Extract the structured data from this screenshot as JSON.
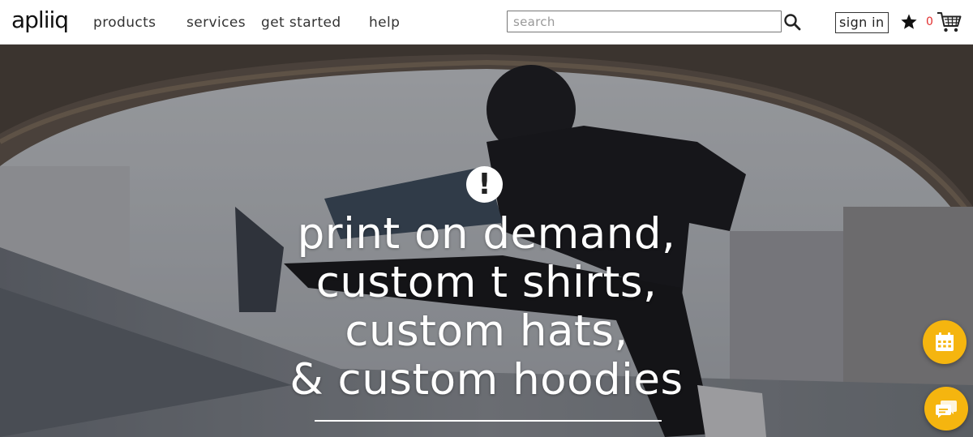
{
  "brand": {
    "logo_text": "apliiq"
  },
  "nav": {
    "items": [
      {
        "label": "products"
      },
      {
        "label": "services"
      },
      {
        "label": "get started"
      },
      {
        "label": "help"
      }
    ]
  },
  "search": {
    "placeholder": "search",
    "value": ""
  },
  "account": {
    "signin_label": "sign in",
    "cart_count": "0"
  },
  "hero": {
    "lines": [
      "print on demand,",
      "custom t shirts,",
      "custom hats,",
      "& custom hoodies"
    ],
    "badge": "!"
  },
  "icons": {
    "search": "search-icon",
    "favorites": "star-icon",
    "cart": "cart-icon",
    "calendar": "calendar-icon",
    "chat": "chat-icon"
  },
  "colors": {
    "accent": "#f5b50f",
    "cart_count": "#e23030"
  }
}
